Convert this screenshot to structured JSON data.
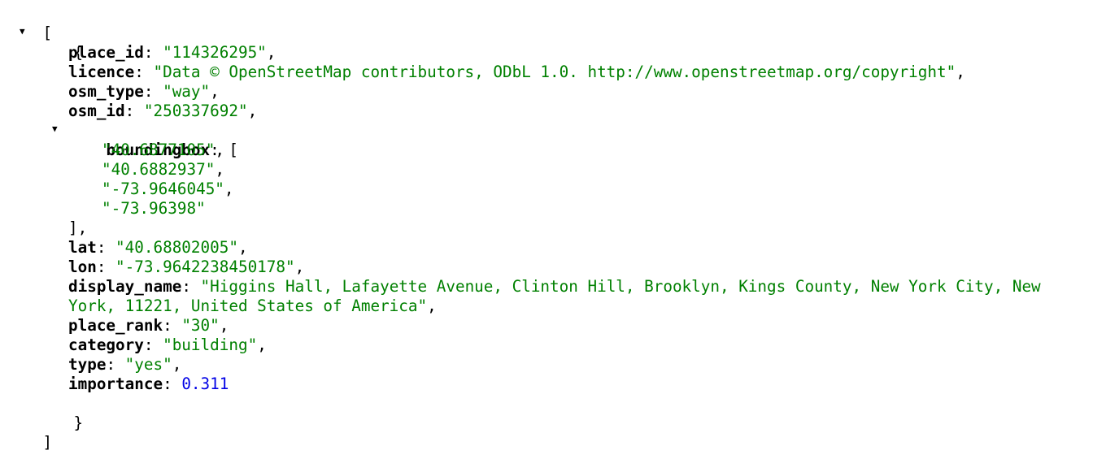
{
  "viewer": {
    "open_array": "[",
    "close_array": "]",
    "open_object": "{",
    "close_object": "}",
    "toggle_glyph": "▼"
  },
  "record": {
    "place_id": {
      "key": "place_id",
      "value": "\"114326295\""
    },
    "licence": {
      "key": "licence",
      "value": "\"Data © OpenStreetMap contributors, ODbL 1.0. http://www.openstreetmap.org/copyright\""
    },
    "osm_type": {
      "key": "osm_type",
      "value": "\"way\""
    },
    "osm_id": {
      "key": "osm_id",
      "value": "\"250337692\""
    },
    "boundingbox": {
      "key": "boundingbox",
      "open": "[",
      "close": "],",
      "values": [
        "\"40.6877105\"",
        "\"40.6882937\"",
        "\"-73.9646045\"",
        "\"-73.96398\""
      ]
    },
    "lat": {
      "key": "lat",
      "value": "\"40.68802005\""
    },
    "lon": {
      "key": "lon",
      "value": "\"-73.9642238450178\""
    },
    "display_name": {
      "key": "display_name",
      "value": "\"Higgins Hall, Lafayette Avenue, Clinton Hill, Brooklyn, Kings County, New York City, New York, 11221, United States of America\""
    },
    "place_rank": {
      "key": "place_rank",
      "value": "\"30\""
    },
    "category": {
      "key": "category",
      "value": "\"building\""
    },
    "type": {
      "key": "type",
      "value": "\"yes\""
    },
    "importance": {
      "key": "importance",
      "value": "0.311"
    }
  }
}
